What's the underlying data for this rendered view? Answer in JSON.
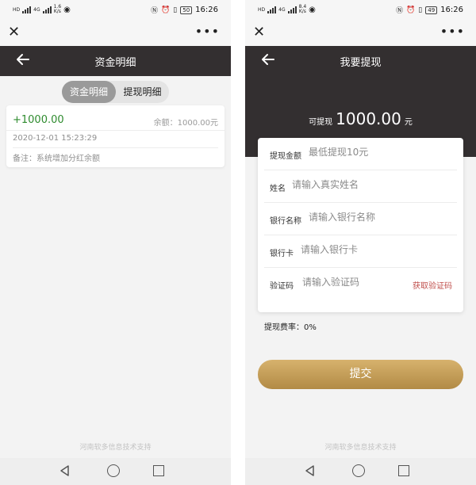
{
  "status_bar": {
    "time": "16:26",
    "left": {
      "tag_hd": "HD",
      "tag_4g": "4G",
      "speed_value": "1.6",
      "speed_unit": "K/s",
      "speed_value_right": "8.4"
    },
    "battery": "50",
    "battery_right": "49"
  },
  "common": {
    "close_icon": "close-icon",
    "more_icon": "more-icon",
    "back_icon": "arrow-left-icon",
    "support_text": "河南软多信息技术支持"
  },
  "left_screen": {
    "title": "资金明细",
    "tabs": [
      "资金明细",
      "提现明细"
    ],
    "active_tab": "资金明细",
    "record": {
      "amount": "+1000.00",
      "balance": "余额：1000.00元",
      "date": "2020-12-01 15:23:29",
      "note": "备注：系统增加分红余额"
    }
  },
  "right_screen": {
    "title": "我要提现",
    "available_label": "可提现",
    "available_value": "1000.00",
    "available_unit": "元",
    "fields": [
      {
        "label": "提现金额",
        "placeholder": "最低提现10元"
      },
      {
        "label": "姓名",
        "placeholder": "请输入真实姓名"
      },
      {
        "label": "银行名称",
        "placeholder": "请输入银行名称"
      },
      {
        "label": "银行卡",
        "placeholder": "请输入银行卡"
      },
      {
        "label": "验证码",
        "placeholder": "请输入验证码"
      }
    ],
    "get_code_label": "获取验证码",
    "fee_text": "提现费率：0%",
    "submit_label": "提交"
  },
  "colors": {
    "header_bg": "#332f30",
    "amount_green": "#2e8b2e",
    "code_red": "#c0504d",
    "submit_gold": "#c8a05a"
  }
}
